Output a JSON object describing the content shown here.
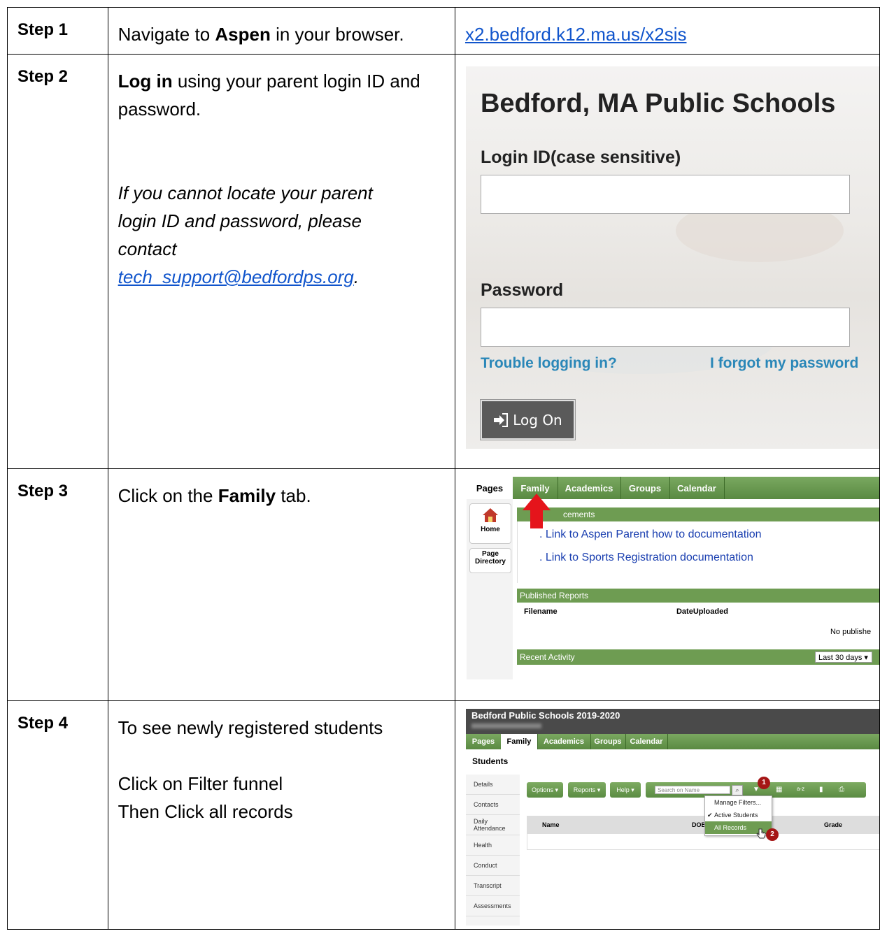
{
  "steps": [
    {
      "label": "Step 1",
      "text_a": "Navigate to ",
      "text_b": "Aspen",
      "text_c": " in your browser.",
      "link": "x2.bedford.k12.ma.us/x2sis"
    },
    {
      "label": "Step 2",
      "bold": "Log in",
      "text": " using your parent login ID and password.",
      "note_line1": "If you cannot locate your parent",
      "note_line2": "login ID and password, please",
      "note_line3": "contact",
      "note_email": "tech_support@bedfordps.org",
      "note_end": "."
    },
    {
      "label": "Step 3",
      "text_a": "Click on the ",
      "text_b": "Family",
      "text_c": " tab."
    },
    {
      "label": "Step 4",
      "line1": "To see newly registered students",
      "line2": "Click on Filter funnel",
      "line3": "Then Click all records"
    }
  ],
  "login_screen": {
    "title": "Bedford, MA Public Schools",
    "login_label": "Login ID(case sensitive)",
    "password_label": "Password",
    "trouble": "Trouble logging in?",
    "forgot": "I forgot my password",
    "log_on": "Log On"
  },
  "family_screen": {
    "pages": "Pages",
    "tabs": [
      "Family",
      "Academics",
      "Groups",
      "Calendar"
    ],
    "home": "Home",
    "page": "Page",
    "directory": "Directory",
    "announcements": "cements",
    "links": [
      "Link to Aspen Parent how to documentation",
      "Link to Sports Registration documentation"
    ],
    "published_reports": "Published Reports",
    "filename": "Filename",
    "date_uploaded": "DateUploaded",
    "no_published": "No publishe",
    "recent_activity": "Recent Activity",
    "range": "Last 30 days"
  },
  "students_screen": {
    "title": "Bedford Public Schools 2019-2020",
    "tabs": [
      "Pages",
      "Family",
      "Academics",
      "Groups",
      "Calendar"
    ],
    "heading": "Students",
    "side": [
      "Details",
      "Contacts",
      "Daily Attendance",
      "Health",
      "Conduct",
      "Transcript",
      "Assessments"
    ],
    "options": "Options",
    "reports": "Reports",
    "help": "Help",
    "search_placeholder": "Search on Name",
    "menu": [
      "Manage Filters...",
      "Active Students",
      "All Records"
    ],
    "col_name": "Name",
    "col_dob": "DOB",
    "col_grade": "Grade",
    "badge1": "1",
    "badge2": "2"
  }
}
